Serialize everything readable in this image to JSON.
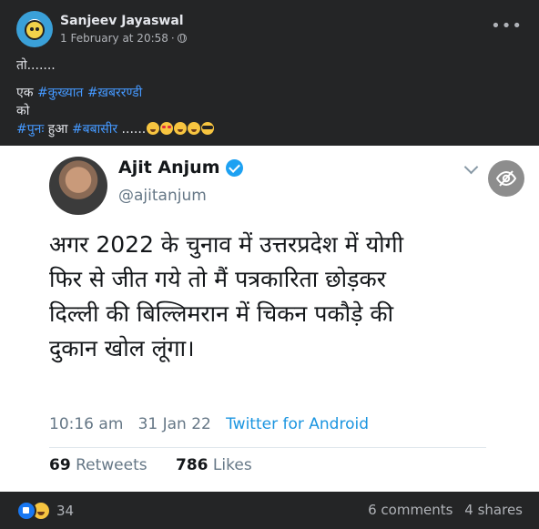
{
  "post": {
    "author": "Sanjeev Jayaswal",
    "timestamp": "1 February at 20:58",
    "separator": "·",
    "privacy_icon": "globe-icon",
    "more_label": "•••",
    "text": {
      "line1": "तो.......",
      "line2_prefix": "एक ",
      "hashtag1": "#कुख्यात",
      "hashtag2": "#ख़बररण्डी",
      "line3": "को",
      "hashtag3": "#पुनः",
      "line4_mid": " हुआ ",
      "hashtag4": "#बबासीर",
      "line4_suffix": " ......",
      "emojis": [
        "laughing-face",
        "heart-eyes-face",
        "rolling-laughing-face",
        "grinning-face",
        "sunglasses-face"
      ]
    }
  },
  "tweet": {
    "name": "Ajit Anjum",
    "handle": "@ajitanjum",
    "verified_icon": "verified-badge-icon",
    "body_lines": [
      "अगर 2022 के चुनाव में उत्तरप्रदेश में योगी",
      "फिर से जीत गये तो मैं पत्रकारिता छोड़कर",
      "दिल्ली की बिल्लिमरान में चिकन पकौड़े की",
      "दुकान खोल लूंगा।"
    ],
    "time": "10:16 am",
    "date": "31 Jan 22",
    "client": "Twitter for Android",
    "retweets_count": "69",
    "retweets_label": "Retweets",
    "likes_count": "786",
    "likes_label": "Likes"
  },
  "footer": {
    "reaction_icons": [
      "like-icon",
      "haha-icon"
    ],
    "reaction_count": "34",
    "comments": "6 comments",
    "shares": "4 shares"
  },
  "colors": {
    "background": "#242526",
    "hashtag": "#4599ff",
    "twitter_blue": "#1da1f2"
  }
}
